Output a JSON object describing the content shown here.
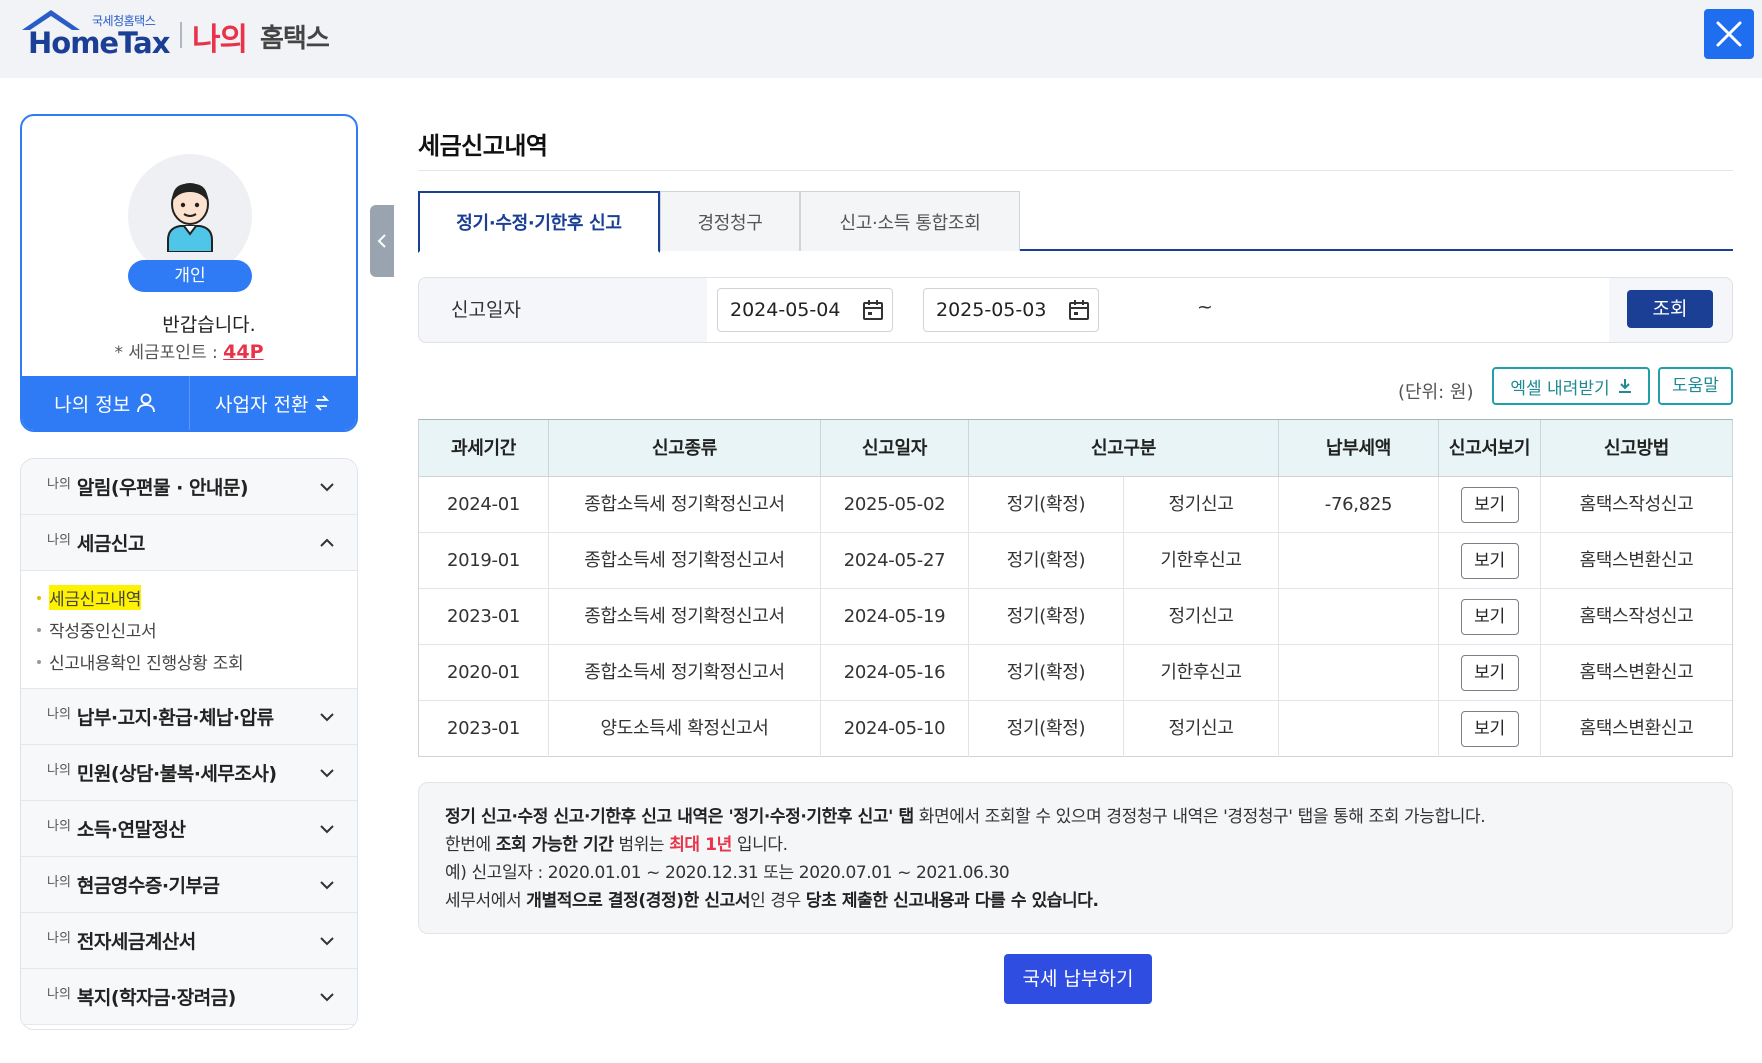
{
  "header": {
    "logo_sub": "국세청홈택스",
    "logo_main": "HomeTax",
    "brand_mine": "나의",
    "brand_hometax": "홈택스"
  },
  "profile": {
    "badge": "개인",
    "greeting": "반갑습니다.",
    "points_label": "* 세금포인트 :",
    "points_value": "44P",
    "my_info": "나의 정보",
    "business_switch": "사업자 전환"
  },
  "menu": {
    "mine_prefix": "나의",
    "items": [
      {
        "label": "알림(우편물 · 안내문)"
      },
      {
        "label": "세금신고"
      },
      {
        "label": "납부·고지·환급·체납·압류"
      },
      {
        "label": "민원(상담·불복·세무조사)"
      },
      {
        "label": "소득·연말정산"
      },
      {
        "label": "현금영수증·기부금"
      },
      {
        "label": "전자세금계산서"
      },
      {
        "label": "복지(학자금·장려금)"
      }
    ],
    "sub_items": [
      {
        "label": "세금신고내역"
      },
      {
        "label": "작성중인신고서"
      },
      {
        "label": "신고내용확인 진행상황 조회"
      }
    ]
  },
  "main": {
    "title": "세금신고내역",
    "tabs": [
      {
        "label": "정기·수정·기한후 신고"
      },
      {
        "label": "경정청구"
      },
      {
        "label": "신고·소득 통합조회"
      }
    ],
    "search": {
      "label": "신고일자",
      "from": "2024-05-04",
      "tilde": "~",
      "to": "2025-05-03",
      "button": "조회"
    },
    "unit": "(단위: 원)",
    "excel_button": "엑셀 내려받기",
    "help_button": "도움말",
    "table": {
      "headers": [
        "과세기간",
        "신고종류",
        "신고일자",
        "신고구분",
        "납부세액",
        "신고서보기",
        "신고방법"
      ],
      "rows": [
        {
          "period": "2024-01",
          "type": "종합소득세 정기확정신고서",
          "date": "2025-05-02",
          "cat1": "정기(확정)",
          "cat2": "정기신고",
          "tax": "-76,825",
          "view": "보기",
          "method": "홈택스작성신고"
        },
        {
          "period": "2019-01",
          "type": "종합소득세 정기확정신고서",
          "date": "2024-05-27",
          "cat1": "정기(확정)",
          "cat2": "기한후신고",
          "tax": "",
          "view": "보기",
          "method": "홈택스변환신고"
        },
        {
          "period": "2023-01",
          "type": "종합소득세 정기확정신고서",
          "date": "2024-05-19",
          "cat1": "정기(확정)",
          "cat2": "정기신고",
          "tax": "",
          "view": "보기",
          "method": "홈택스작성신고"
        },
        {
          "period": "2020-01",
          "type": "종합소득세 정기확정신고서",
          "date": "2024-05-16",
          "cat1": "정기(확정)",
          "cat2": "기한후신고",
          "tax": "",
          "view": "보기",
          "method": "홈택스변환신고"
        },
        {
          "period": "2023-01",
          "type": "양도소득세 확정신고서",
          "date": "2024-05-10",
          "cat1": "정기(확정)",
          "cat2": "정기신고",
          "tax": "",
          "view": "보기",
          "method": "홈택스변환신고"
        }
      ]
    },
    "notice": {
      "l1_b1": "정기 신고·수정 신고·기한후 신고 내역은 '정기·수정·기한후 신고' 탭",
      "l1_t1": " 화면에서 조회할 수 있으며 경정청구 내역은  '경정청구' 탭을 통해 조회 가능합니다.",
      "l2_t1": "한번에 ",
      "l2_b1": "조회 가능한 기간",
      "l2_t2": " 범위는 ",
      "l2_r1": "최대 1년",
      "l2_t3": " 입니다.",
      "l3": "예) 신고일자 : 2020.01.01 ~ 2020.12.31 또는 2020.07.01 ~ 2021.06.30",
      "l4_t1": "세무서에서 ",
      "l4_b1": "개별적으로 결정(경정)한 신고서",
      "l4_t2": "인 경우 ",
      "l4_b2": "당초 제출한 신고내용과 다를 수 있습니다."
    },
    "pay_button": "국세 납부하기"
  },
  "colors": {
    "primary_blue": "#2f7bf5",
    "navy": "#1a3f95",
    "teal": "#22a0a8",
    "red": "#e8334a",
    "highlight": "#fff200"
  }
}
